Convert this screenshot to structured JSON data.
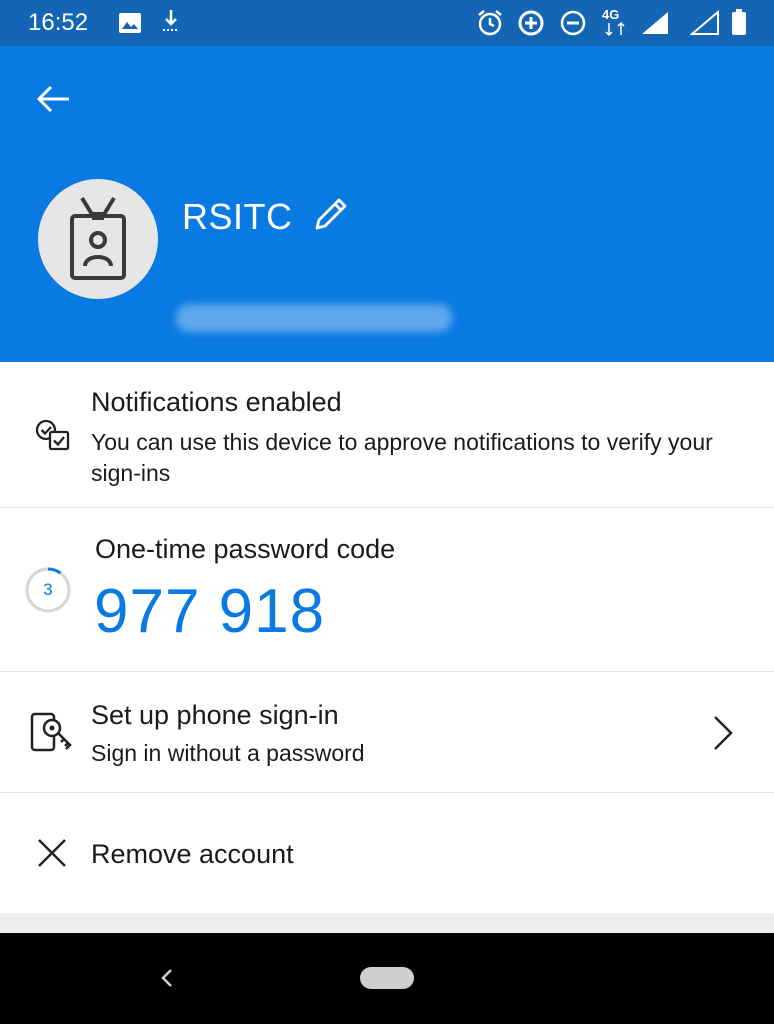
{
  "status_bar": {
    "time": "16:52",
    "icons": [
      "image-icon",
      "download-icon",
      "alarm-icon",
      "data-saver-icon",
      "do-not-disturb-icon",
      "4g-icon",
      "signal-icon",
      "signal-empty-icon",
      "battery-icon"
    ],
    "network_label": "4G"
  },
  "header": {
    "back_icon": "arrow-left-icon",
    "avatar_icon": "id-badge-icon",
    "account_name": "RSITC",
    "edit_icon": "pencil-icon"
  },
  "notifications": {
    "icon": "notification-check-icon",
    "title": "Notifications enabled",
    "subtitle": "You can use this device to approve notifications to verify your sign-ins"
  },
  "otp": {
    "title": "One-time password code",
    "code": "977 918",
    "timer_seconds": "3",
    "timer_progress": 0.1
  },
  "phone_signin": {
    "icon": "phone-key-icon",
    "title": "Set up phone sign-in",
    "subtitle": "Sign in without a password",
    "chevron_icon": "chevron-right-icon"
  },
  "remove": {
    "icon": "close-icon",
    "title": "Remove account"
  },
  "colors": {
    "status_bar": "#1565b5",
    "header": "#0a7ae3",
    "accent": "#0a7ae3"
  }
}
